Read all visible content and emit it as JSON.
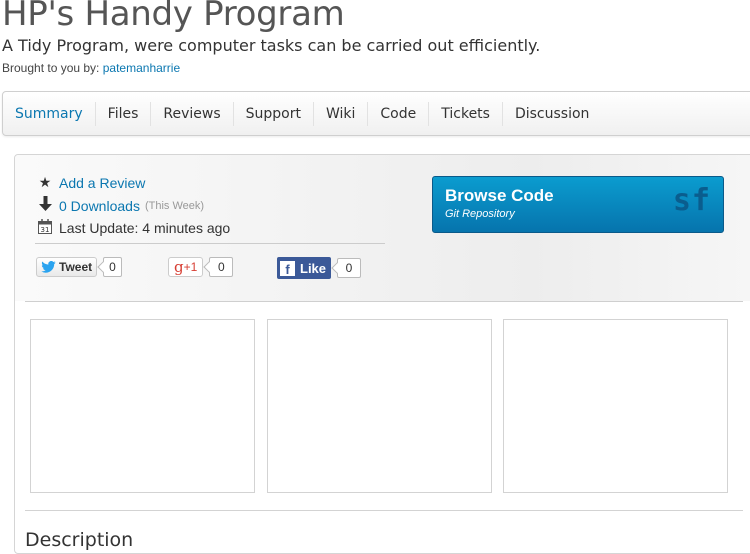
{
  "header": {
    "title": "HP's Handy Program",
    "subtitle": "A Tidy Program, were computer tasks can be carried out efficiently.",
    "brought_by_label": "Brought to you by:",
    "author": "patemanharrie"
  },
  "tabs": [
    {
      "label": "Summary",
      "active": true
    },
    {
      "label": "Files"
    },
    {
      "label": "Reviews"
    },
    {
      "label": "Support"
    },
    {
      "label": "Wiki"
    },
    {
      "label": "Code"
    },
    {
      "label": "Tickets"
    },
    {
      "label": "Discussion"
    }
  ],
  "summary": {
    "add_review": "Add a Review",
    "downloads": "0 Downloads",
    "downloads_period": "(This Week)",
    "last_update": "Last Update: 4 minutes ago",
    "calendar_day": "31"
  },
  "social": {
    "tweet_label": "Tweet",
    "tweet_count": "0",
    "gplus_label": "+1",
    "gplus_count": "0",
    "like_label": "Like",
    "like_count": "0"
  },
  "browse": {
    "title": "Browse Code",
    "subtitle": "Git Repository",
    "logo": "sf",
    "color": "#0b8bc2"
  },
  "description": {
    "heading": "Description"
  }
}
